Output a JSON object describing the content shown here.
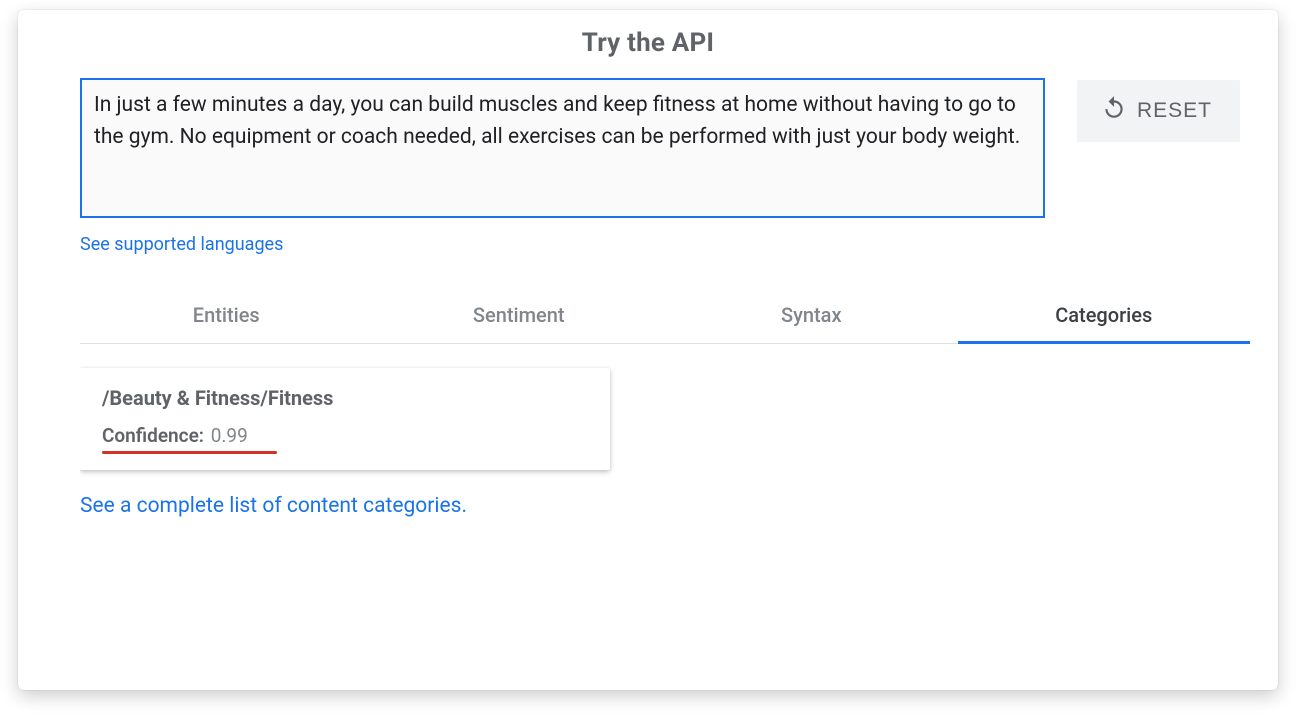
{
  "header": {
    "title": "Try the API"
  },
  "input": {
    "text": "In just a few minutes a day, you can build muscles and keep fitness at home without having to go to the gym. No equipment or coach needed, all exercises can be performed with just your body weight."
  },
  "reset_label": "RESET",
  "supported_languages_link": "See supported languages",
  "tabs": [
    {
      "label": "Entities"
    },
    {
      "label": "Sentiment"
    },
    {
      "label": "Syntax"
    },
    {
      "label": "Categories"
    }
  ],
  "active_tab_index": 3,
  "result": {
    "category_path": "/Beauty & Fitness/Fitness",
    "confidence_label": "Confidence:",
    "confidence_value": "0.99",
    "all_categories_link": "See a complete list of content categories."
  },
  "colors": {
    "accent": "#1a73e8",
    "annotation_red": "#d93025"
  }
}
